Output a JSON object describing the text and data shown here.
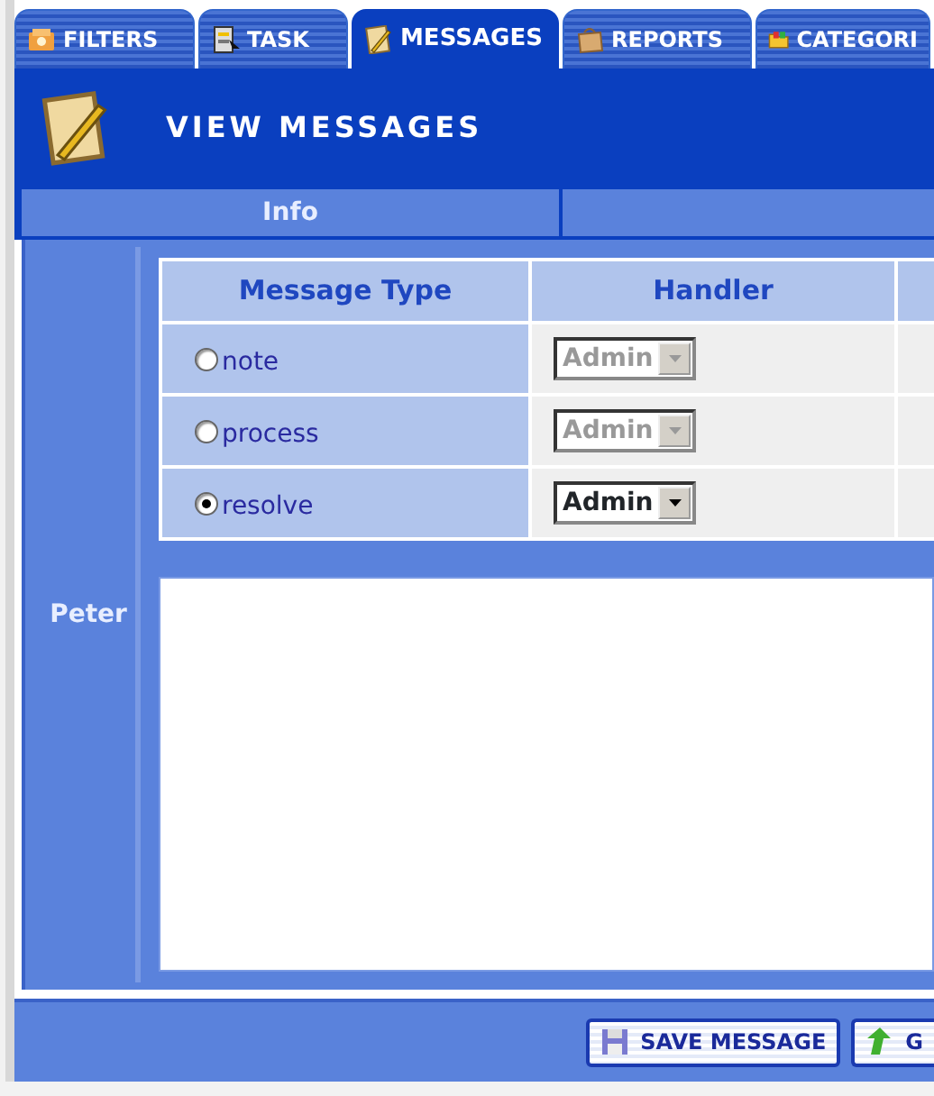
{
  "tabs": [
    {
      "label": "FILTERS",
      "selected": false
    },
    {
      "label": "TASK",
      "selected": false
    },
    {
      "label": "MESSAGES",
      "selected": true
    },
    {
      "label": "REPORTS",
      "selected": false
    },
    {
      "label": "CATEGORI",
      "selected": false
    }
  ],
  "header": {
    "title": "VIEW MESSAGES"
  },
  "info_bar": {
    "columns": [
      "Info"
    ]
  },
  "person": {
    "name": "Peter"
  },
  "message_table": {
    "columns": [
      "Message Type",
      "Handler"
    ],
    "rows": [
      {
        "type": "note",
        "selected": false,
        "handler": "Admin",
        "disabled": true
      },
      {
        "type": "process",
        "selected": false,
        "handler": "Admin",
        "disabled": true
      },
      {
        "type": "resolve",
        "selected": true,
        "handler": "Admin",
        "disabled": false
      }
    ]
  },
  "buttons": [
    {
      "label": "SAVE MESSAGE"
    },
    {
      "label": "G"
    }
  ]
}
